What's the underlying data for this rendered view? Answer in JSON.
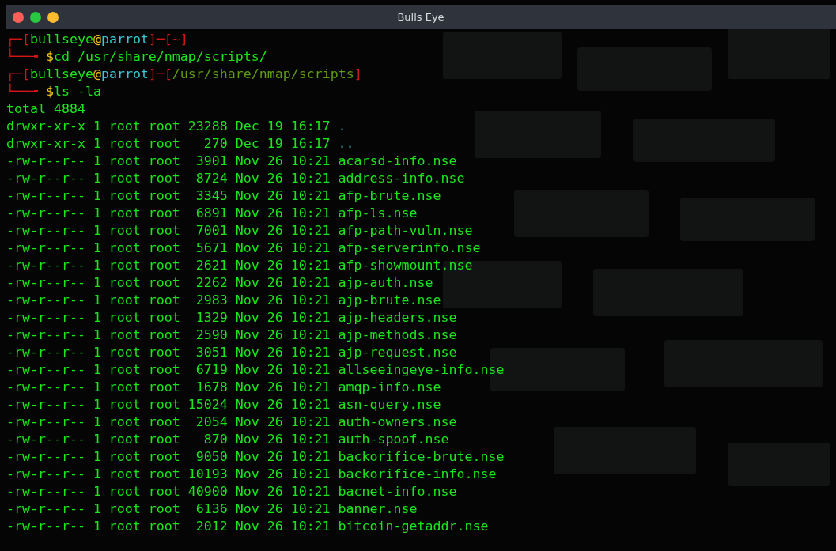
{
  "window": {
    "title": "Bulls Eye",
    "controls": [
      {
        "kind": "close"
      },
      {
        "kind": "minimize"
      },
      {
        "kind": "maximize"
      }
    ]
  },
  "terminal": {
    "blocks": [
      {
        "prompt": [
          {
            "kind": "frame",
            "text": "┌─["
          },
          {
            "kind": "user",
            "text": "bullseye"
          },
          {
            "kind": "at",
            "text": "@"
          },
          {
            "kind": "host",
            "text": "parrot"
          },
          {
            "kind": "frame",
            "text": "]─["
          },
          {
            "kind": "home",
            "text": "~"
          },
          {
            "kind": "frame",
            "text": "]"
          }
        ],
        "command": [
          {
            "kind": "frame",
            "text": "└──╼ "
          },
          {
            "kind": "dollar",
            "text": "$"
          },
          {
            "kind": "cmd",
            "text": "cd /usr/share/nmap/scripts/"
          }
        ]
      },
      {
        "prompt": [
          {
            "kind": "frame",
            "text": "┌─["
          },
          {
            "kind": "user",
            "text": "bullseye"
          },
          {
            "kind": "at",
            "text": "@"
          },
          {
            "kind": "host",
            "text": "parrot"
          },
          {
            "kind": "frame",
            "text": "]─["
          },
          {
            "kind": "path",
            "text": "/usr/share/nmap/scripts"
          },
          {
            "kind": "frame",
            "text": "]"
          }
        ],
        "command": [
          {
            "kind": "frame",
            "text": "└──╼ "
          },
          {
            "kind": "dollar",
            "text": "$"
          },
          {
            "kind": "cmd",
            "text": "ls -la"
          }
        ]
      }
    ],
    "total": "total 4884",
    "listing": [
      {
        "kind": "dir",
        "permissions": "drwxr-xr-x",
        "links": "1",
        "owner": "root",
        "group": "root",
        "size": "23288",
        "month": "Dec",
        "day": "19",
        "time": "16:17",
        "name": "."
      },
      {
        "kind": "dir",
        "permissions": "drwxr-xr-x",
        "links": "1",
        "owner": "root",
        "group": "root",
        "size": "270",
        "month": "Dec",
        "day": "19",
        "time": "16:17",
        "name": ".."
      },
      {
        "kind": "file",
        "permissions": "-rw-r--r--",
        "links": "1",
        "owner": "root",
        "group": "root",
        "size": "3901",
        "month": "Nov",
        "day": "26",
        "time": "10:21",
        "name": "acarsd-info.nse"
      },
      {
        "kind": "file",
        "permissions": "-rw-r--r--",
        "links": "1",
        "owner": "root",
        "group": "root",
        "size": "8724",
        "month": "Nov",
        "day": "26",
        "time": "10:21",
        "name": "address-info.nse"
      },
      {
        "kind": "file",
        "permissions": "-rw-r--r--",
        "links": "1",
        "owner": "root",
        "group": "root",
        "size": "3345",
        "month": "Nov",
        "day": "26",
        "time": "10:21",
        "name": "afp-brute.nse"
      },
      {
        "kind": "file",
        "permissions": "-rw-r--r--",
        "links": "1",
        "owner": "root",
        "group": "root",
        "size": "6891",
        "month": "Nov",
        "day": "26",
        "time": "10:21",
        "name": "afp-ls.nse"
      },
      {
        "kind": "file",
        "permissions": "-rw-r--r--",
        "links": "1",
        "owner": "root",
        "group": "root",
        "size": "7001",
        "month": "Nov",
        "day": "26",
        "time": "10:21",
        "name": "afp-path-vuln.nse"
      },
      {
        "kind": "file",
        "permissions": "-rw-r--r--",
        "links": "1",
        "owner": "root",
        "group": "root",
        "size": "5671",
        "month": "Nov",
        "day": "26",
        "time": "10:21",
        "name": "afp-serverinfo.nse"
      },
      {
        "kind": "file",
        "permissions": "-rw-r--r--",
        "links": "1",
        "owner": "root",
        "group": "root",
        "size": "2621",
        "month": "Nov",
        "day": "26",
        "time": "10:21",
        "name": "afp-showmount.nse"
      },
      {
        "kind": "file",
        "permissions": "-rw-r--r--",
        "links": "1",
        "owner": "root",
        "group": "root",
        "size": "2262",
        "month": "Nov",
        "day": "26",
        "time": "10:21",
        "name": "ajp-auth.nse"
      },
      {
        "kind": "file",
        "permissions": "-rw-r--r--",
        "links": "1",
        "owner": "root",
        "group": "root",
        "size": "2983",
        "month": "Nov",
        "day": "26",
        "time": "10:21",
        "name": "ajp-brute.nse"
      },
      {
        "kind": "file",
        "permissions": "-rw-r--r--",
        "links": "1",
        "owner": "root",
        "group": "root",
        "size": "1329",
        "month": "Nov",
        "day": "26",
        "time": "10:21",
        "name": "ajp-headers.nse"
      },
      {
        "kind": "file",
        "permissions": "-rw-r--r--",
        "links": "1",
        "owner": "root",
        "group": "root",
        "size": "2590",
        "month": "Nov",
        "day": "26",
        "time": "10:21",
        "name": "ajp-methods.nse"
      },
      {
        "kind": "file",
        "permissions": "-rw-r--r--",
        "links": "1",
        "owner": "root",
        "group": "root",
        "size": "3051",
        "month": "Nov",
        "day": "26",
        "time": "10:21",
        "name": "ajp-request.nse"
      },
      {
        "kind": "file",
        "permissions": "-rw-r--r--",
        "links": "1",
        "owner": "root",
        "group": "root",
        "size": "6719",
        "month": "Nov",
        "day": "26",
        "time": "10:21",
        "name": "allseeingeye-info.nse"
      },
      {
        "kind": "file",
        "permissions": "-rw-r--r--",
        "links": "1",
        "owner": "root",
        "group": "root",
        "size": "1678",
        "month": "Nov",
        "day": "26",
        "time": "10:21",
        "name": "amqp-info.nse"
      },
      {
        "kind": "file",
        "permissions": "-rw-r--r--",
        "links": "1",
        "owner": "root",
        "group": "root",
        "size": "15024",
        "month": "Nov",
        "day": "26",
        "time": "10:21",
        "name": "asn-query.nse"
      },
      {
        "kind": "file",
        "permissions": "-rw-r--r--",
        "links": "1",
        "owner": "root",
        "group": "root",
        "size": "2054",
        "month": "Nov",
        "day": "26",
        "time": "10:21",
        "name": "auth-owners.nse"
      },
      {
        "kind": "file",
        "permissions": "-rw-r--r--",
        "links": "1",
        "owner": "root",
        "group": "root",
        "size": "870",
        "month": "Nov",
        "day": "26",
        "time": "10:21",
        "name": "auth-spoof.nse"
      },
      {
        "kind": "file",
        "permissions": "-rw-r--r--",
        "links": "1",
        "owner": "root",
        "group": "root",
        "size": "9050",
        "month": "Nov",
        "day": "26",
        "time": "10:21",
        "name": "backorifice-brute.nse"
      },
      {
        "kind": "file",
        "permissions": "-rw-r--r--",
        "links": "1",
        "owner": "root",
        "group": "root",
        "size": "10193",
        "month": "Nov",
        "day": "26",
        "time": "10:21",
        "name": "backorifice-info.nse"
      },
      {
        "kind": "file",
        "permissions": "-rw-r--r--",
        "links": "1",
        "owner": "root",
        "group": "root",
        "size": "40900",
        "month": "Nov",
        "day": "26",
        "time": "10:21",
        "name": "bacnet-info.nse"
      },
      {
        "kind": "file",
        "permissions": "-rw-r--r--",
        "links": "1",
        "owner": "root",
        "group": "root",
        "size": "6136",
        "month": "Nov",
        "day": "26",
        "time": "10:21",
        "name": "banner.nse"
      },
      {
        "kind": "file",
        "permissions": "-rw-r--r--",
        "links": "1",
        "owner": "root",
        "group": "root",
        "size": "2012",
        "month": "Nov",
        "day": "26",
        "time": "10:21",
        "name": "bitcoin-getaddr.nse"
      }
    ]
  }
}
